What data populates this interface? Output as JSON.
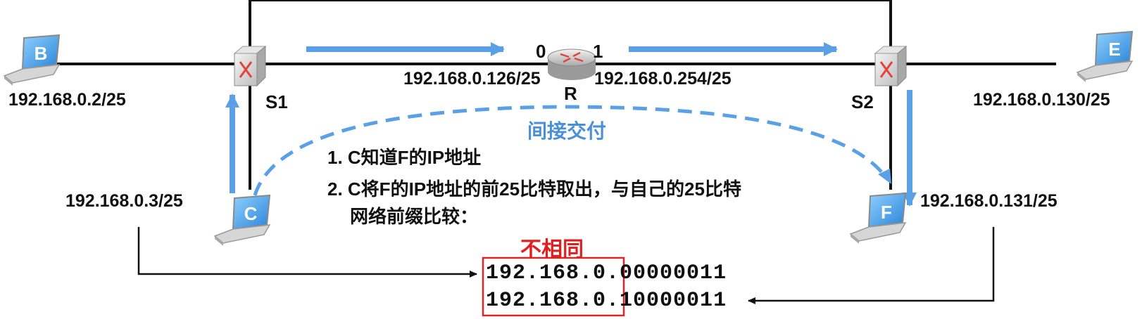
{
  "colors": {
    "arrow_blue": "#5aa0e6",
    "link_black": "#111111",
    "highlight_red": "#d9262c",
    "label_blue": "#4a90d9"
  },
  "hosts": {
    "B": {
      "letter": "B",
      "ip": "192.168.0.2/25"
    },
    "C": {
      "letter": "C",
      "ip": "192.168.0.3/25"
    },
    "E": {
      "letter": "E",
      "ip": "192.168.0.130/25"
    },
    "F": {
      "letter": "F",
      "ip": "192.168.0.131/25"
    }
  },
  "switches": {
    "S1": {
      "name": "S1"
    },
    "S2": {
      "name": "S2"
    }
  },
  "router": {
    "name": "R",
    "port0": {
      "num": "0",
      "ip": "192.168.0.126/25"
    },
    "port1": {
      "num": "1",
      "ip": "192.168.0.254/25"
    }
  },
  "path_label": "间接交付",
  "steps": [
    "1. C知道F的IP地址",
    "2. C将F的IP地址的前25比特取出，与自己的25比特",
    "网络前缀比较："
  ],
  "comparison": {
    "result_label": "不相同",
    "row1": {
      "prefix": "192.168.0.0",
      "suffix": "0000011"
    },
    "row2": {
      "prefix": "192.168.0.1",
      "suffix": "0000011"
    }
  }
}
